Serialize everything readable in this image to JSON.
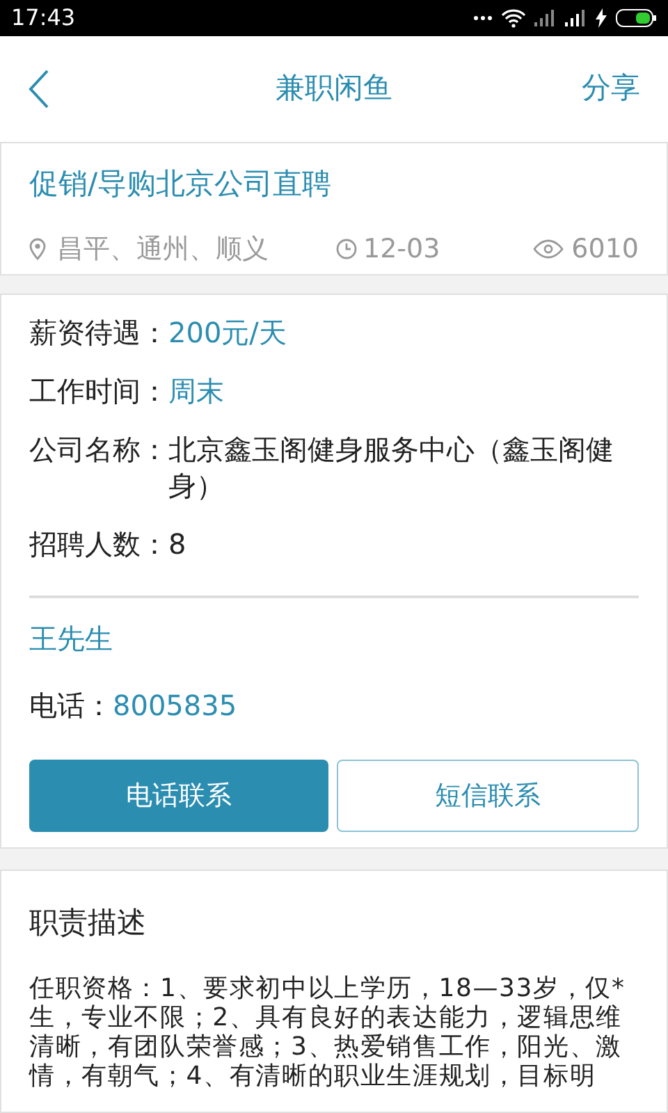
{
  "status_bar": {
    "time": "17:43"
  },
  "header": {
    "title": "兼职闲鱼",
    "action": "分享"
  },
  "job": {
    "title": "促销/导购北京公司直聘",
    "location": "昌平、通州、顺义",
    "date": "12-03",
    "views": "6010"
  },
  "details": [
    {
      "label": "薪资待遇：",
      "value": "200元/天",
      "highlight": true
    },
    {
      "label": "工作时间：",
      "value": "周末",
      "highlight": true
    },
    {
      "label": "公司名称：",
      "value": "北京鑫玉阁健身服务中心（鑫玉阁健身）",
      "highlight": false
    },
    {
      "label": "招聘人数：",
      "value": "8",
      "highlight": false
    }
  ],
  "contact": {
    "name": "王先生",
    "phone_label": "电话：",
    "phone": "8005835"
  },
  "buttons": [
    {
      "label": "电话联系",
      "kind": "primary"
    },
    {
      "label": "短信联系",
      "kind": "outline"
    }
  ],
  "description": {
    "title": "职责描述",
    "text": "任职资格：1、要求初中以上学历，18—33岁，仅*生，专业不限；2、具有良好的表达能力，逻辑思维清晰，有团队荣誉感；3、热爱销售工作，阳光、激情，有朝气；4、有清晰的职业生涯规划，目标明"
  }
}
